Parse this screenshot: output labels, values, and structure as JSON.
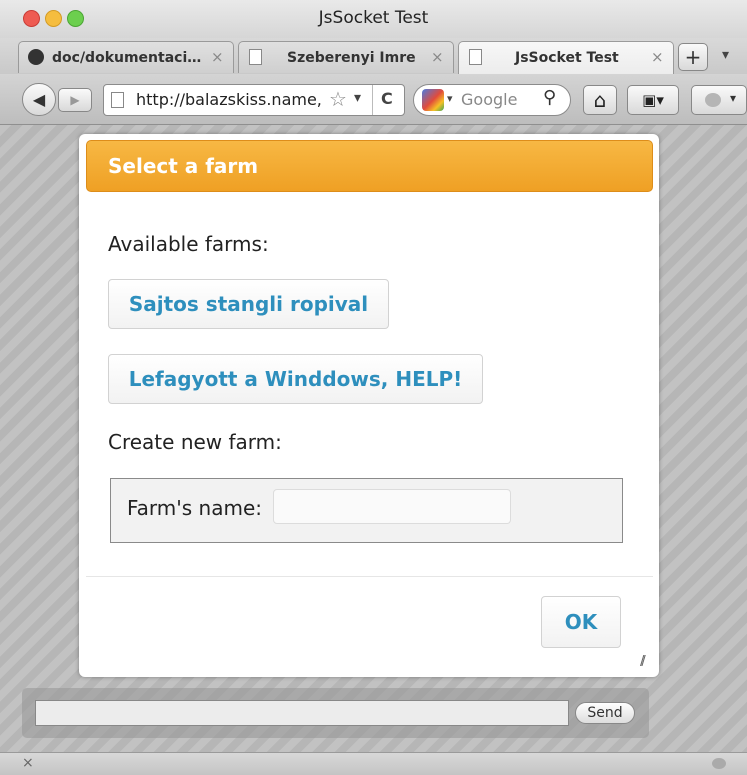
{
  "window": {
    "title": "JsSocket Test"
  },
  "tabs": [
    {
      "label": "doc/dokumentaci…",
      "close": "×"
    },
    {
      "label": "Szeberenyi Imre",
      "close": "×"
    },
    {
      "label": "JsSocket Test",
      "close": "×"
    }
  ],
  "tabbar": {
    "new_tab": "+",
    "list_tabs": "▾"
  },
  "navbar": {
    "back": "◀",
    "forward": "▶",
    "url": "http://balazskiss.name,",
    "bookmark_star": "☆",
    "dropdown": "▾",
    "reload": "C",
    "search_engine": "Google",
    "search_glyph": "⚲",
    "home": "⌂",
    "bookmarks_menu": "▣▾"
  },
  "dialog": {
    "title": "Select a farm",
    "available_label": "Available farms:",
    "farms": [
      "Sajtos stangli ropival",
      "Lefagyott a Winddows, HELP!"
    ],
    "create_label": "Create new farm:",
    "farm_name_label": "Farm's name:",
    "farm_name_value": "",
    "ok_label": "OK",
    "resize_glyph": "//"
  },
  "chat": {
    "input_value": "",
    "send_label": "Send"
  },
  "statusbar": {
    "close": "×"
  },
  "colors": {
    "header_orange": "#f2a52c",
    "button_text_blue": "#2e8fbd"
  }
}
